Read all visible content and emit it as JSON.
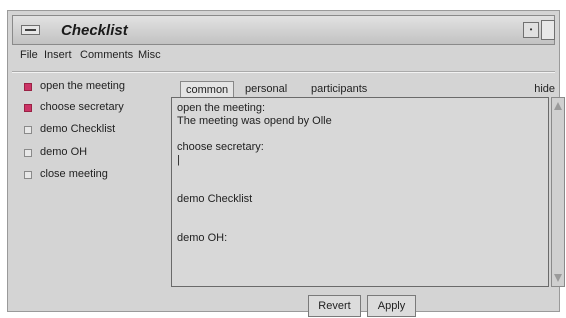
{
  "window": {
    "title": "Checklist",
    "system_menu_icon": "window-menu-icon",
    "button_1_glyph": "•",
    "button_2_icon": "maximize-icon"
  },
  "menubar": {
    "items": [
      "File",
      "Insert",
      "Comments",
      "Misc"
    ]
  },
  "checklist": {
    "items": [
      {
        "label": "open the meeting",
        "checked": true
      },
      {
        "label": "choose secretary",
        "checked": true
      },
      {
        "label": "demo Checklist",
        "checked": false
      },
      {
        "label": "demo OH",
        "checked": false
      },
      {
        "label": "close meeting",
        "checked": false
      }
    ],
    "checked_color": "#cc3366"
  },
  "tabs": {
    "items": [
      "common",
      "personal",
      "participants"
    ],
    "active": "common",
    "hide_label": "hide"
  },
  "editor": {
    "content": "open the meeting:\nThe meeting was opend by Olle\n\nchoose secretary:\n|\n\n\ndemo Checklist\n\n\ndemo OH:"
  },
  "buttons": {
    "revert": "Revert",
    "apply": "Apply"
  }
}
